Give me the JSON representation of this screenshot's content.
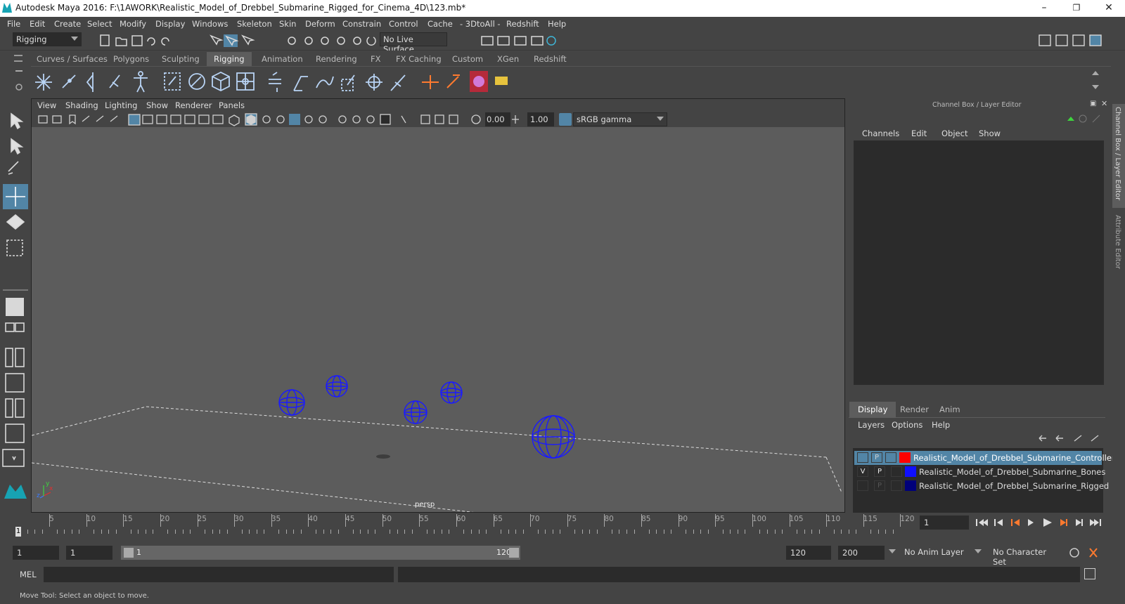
{
  "titlebar": {
    "title": "Autodesk Maya 2016: F:\\1AWORK\\Realistic_Model_of_Drebbel_Submarine_Rigged_for_Cinema_4D\\123.mb*",
    "minimize": "–",
    "restore": "❐",
    "close": "✕"
  },
  "menubar": [
    "File",
    "Edit",
    "Create",
    "Select",
    "Modify",
    "Display",
    "Windows",
    "Skeleton",
    "Skin",
    "Deform",
    "Constrain",
    "Control",
    "Cache",
    "- 3DtoAll -",
    "Redshift",
    "Help"
  ],
  "statusline": {
    "menuset": "Rigging",
    "live_surface": "No Live Surface"
  },
  "shelf_tabs": [
    "Curves / Surfaces",
    "Polygons",
    "Sculpting",
    "Rigging",
    "Animation",
    "Rendering",
    "FX",
    "FX Caching",
    "Custom",
    "XGen",
    "Redshift"
  ],
  "active_shelf": "Rigging",
  "viewport": {
    "menu": [
      "View",
      "Shading",
      "Lighting",
      "Show",
      "Renderer",
      "Panels"
    ],
    "exposure": "0.00",
    "gamma": "1.00",
    "colorspace": "sRGB gamma",
    "camera_label": "persp",
    "axis_x": "x",
    "axis_y": "y",
    "axis_z": "z"
  },
  "channel_box": {
    "title": "Channel Box / Layer Editor",
    "menu": [
      "Channels",
      "Edit",
      "Object",
      "Show"
    ]
  },
  "side_tabs": [
    "Channel Box / Layer Editor",
    "Attribute Editor"
  ],
  "layer_editor": {
    "tabs": [
      "Display",
      "Render",
      "Anim"
    ],
    "active_tab": "Display",
    "menu": [
      "Layers",
      "Options",
      "Help"
    ],
    "layers": [
      {
        "v": "",
        "p": "P",
        "name": "Realistic_Model_of_Drebbel_Submarine_Controllers",
        "color": "#ff0000",
        "selected": true
      },
      {
        "v": "V",
        "p": "P",
        "name": "Realistic_Model_of_Drebbel_Submarine_Bones",
        "color": "#1010ff",
        "selected": false
      },
      {
        "v": "",
        "p": "P",
        "name": "Realistic_Model_of_Drebbel_Submarine_Rigged",
        "color": "#00007a",
        "selected": false
      }
    ]
  },
  "timeline": {
    "ticks": [
      5,
      10,
      15,
      20,
      25,
      30,
      35,
      40,
      45,
      50,
      55,
      60,
      65,
      70,
      75,
      80,
      85,
      90,
      95,
      100,
      105,
      110,
      115,
      120
    ],
    "current_frame_marker": "1",
    "current_frame": "1"
  },
  "range": {
    "start": "1",
    "playback_start": "1",
    "slider_start": "1",
    "slider_end": "120",
    "playback_end": "120",
    "end": "200",
    "anim_layer": "No Anim Layer",
    "character_set": "No Character Set"
  },
  "mel": {
    "label": "MEL"
  },
  "helpline": "Move Tool: Select an object to move.",
  "colors": {
    "accent": "#5285a6",
    "viewport_bg": "#5c5c5c",
    "wire": "#1a1aff"
  }
}
